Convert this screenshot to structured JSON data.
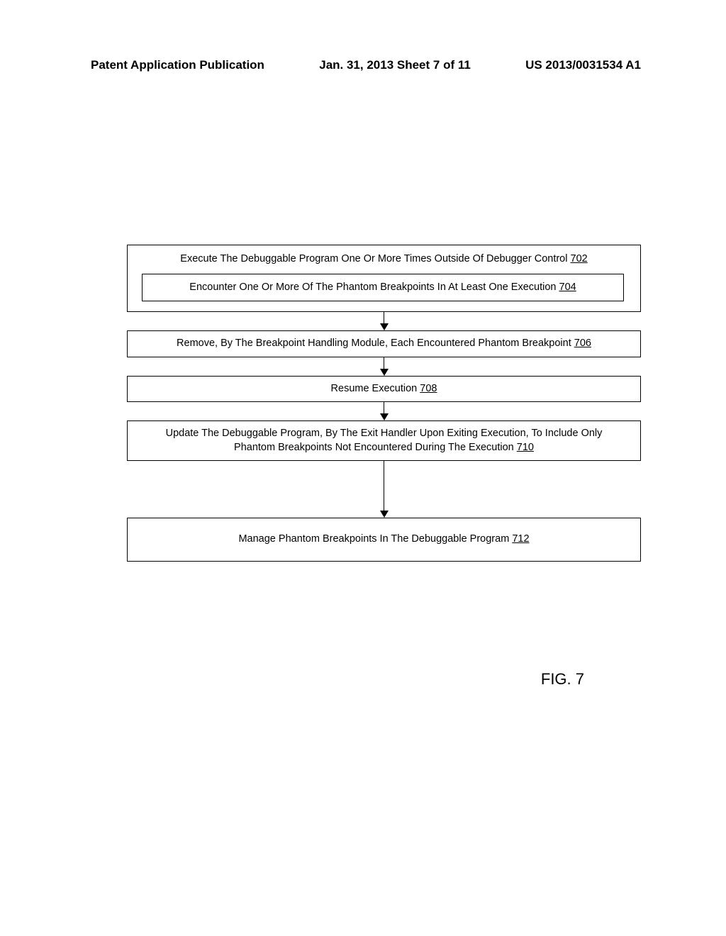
{
  "header": {
    "left": "Patent Application Publication",
    "center": "Jan. 31, 2013  Sheet 7 of 11",
    "right": "US 2013/0031534 A1"
  },
  "flow": {
    "step702": {
      "text": "Execute The Debuggable Program One Or More Times Outside Of Debugger Control ",
      "ref": "702"
    },
    "step704": {
      "text": "Encounter One Or More Of The Phantom Breakpoints In At Least One Execution ",
      "ref": "704"
    },
    "step706": {
      "text": "Remove, By The Breakpoint Handling Module, Each Encountered Phantom Breakpoint ",
      "ref": "706"
    },
    "step708": {
      "text": "Resume Execution ",
      "ref": "708"
    },
    "step710": {
      "text1": "Update The Debuggable Program, By The Exit Handler Upon Exiting Execution, To Include Only",
      "text2": "Phantom Breakpoints Not Encountered During The Execution ",
      "ref": "710"
    },
    "step712": {
      "text": "Manage Phantom Breakpoints In The Debuggable Program ",
      "ref": "712"
    }
  },
  "figure_label": "FIG. 7"
}
